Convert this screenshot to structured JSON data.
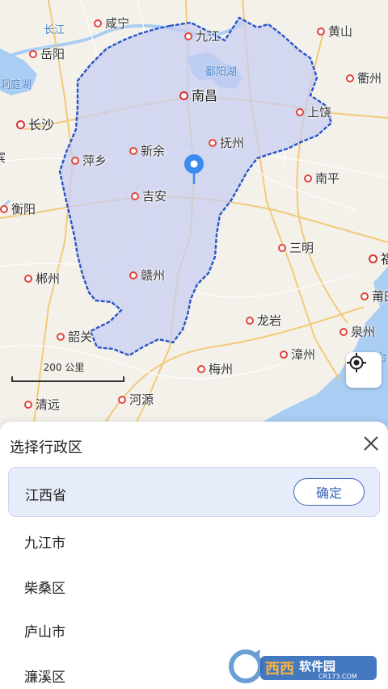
{
  "map": {
    "water_labels": [
      {
        "id": "yangtze",
        "text": "长江"
      },
      {
        "id": "dongting",
        "text": "洞庭湖"
      },
      {
        "id": "poyang",
        "text": "鄱阳湖"
      },
      {
        "id": "taiwan-strait",
        "text": "台"
      }
    ],
    "cities": [
      {
        "id": "xianning",
        "text": "咸宁",
        "capital": false
      },
      {
        "id": "jiujiang",
        "text": "九江",
        "capital": false
      },
      {
        "id": "huangshan",
        "text": "黄山",
        "capital": false
      },
      {
        "id": "yueyang",
        "text": "岳阳",
        "capital": false
      },
      {
        "id": "quzhou",
        "text": "衢州",
        "capital": false
      },
      {
        "id": "nanchang",
        "text": "南昌",
        "capital": true
      },
      {
        "id": "shangrao",
        "text": "上饶",
        "capital": false
      },
      {
        "id": "changsha",
        "text": "长沙",
        "capital": true
      },
      {
        "id": "fuzhou-jx",
        "text": "抚州",
        "capital": false
      },
      {
        "id": "pingxiang",
        "text": "萍乡",
        "capital": false
      },
      {
        "id": "xinyu",
        "text": "新余",
        "capital": false
      },
      {
        "id": "nanping",
        "text": "南平",
        "capital": false
      },
      {
        "id": "jian",
        "text": "吉安",
        "capital": false
      },
      {
        "id": "hengyang",
        "text": "衡阳",
        "capital": false
      },
      {
        "id": "sanming",
        "text": "三明",
        "capital": false
      },
      {
        "id": "fuzhou-fj",
        "text": "福",
        "capital": true
      },
      {
        "id": "chenzhou",
        "text": "郴州",
        "capital": false
      },
      {
        "id": "ganzhou",
        "text": "赣州",
        "capital": false
      },
      {
        "id": "putian",
        "text": "莆田",
        "capital": false
      },
      {
        "id": "longyan",
        "text": "龙岩",
        "capital": false
      },
      {
        "id": "shaoguan",
        "text": "韶关",
        "capital": false
      },
      {
        "id": "quanzhou",
        "text": "泉州",
        "capital": false
      },
      {
        "id": "zhangzhou",
        "text": "漳州",
        "capital": false
      },
      {
        "id": "meizhou",
        "text": "梅州",
        "capital": false
      },
      {
        "id": "heyuan",
        "text": "河源",
        "capital": false
      },
      {
        "id": "qingyuan",
        "text": "清远",
        "capital": false
      }
    ],
    "partial_labels": [
      {
        "id": "edge-left",
        "text": "宾"
      }
    ],
    "scale_text": "200 公里"
  },
  "sheet": {
    "title": "选择行政区",
    "selected": "江西省",
    "confirm_label": "确定",
    "options": [
      "九江市",
      "柴桑区",
      "庐山市",
      "濂溪区"
    ]
  },
  "watermark": {
    "brand": "西西软件园",
    "domain": "CR173.COM"
  },
  "colors": {
    "province_fill": "#c6cdf3",
    "province_border": "#2955c8",
    "marker": "#3b8af0",
    "accent": "#3a66b8"
  }
}
